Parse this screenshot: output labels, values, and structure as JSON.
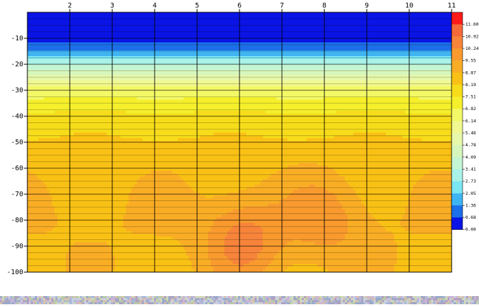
{
  "chart_data": {
    "type": "heatmap",
    "title": "",
    "xlabel": "",
    "ylabel": "",
    "x_ticks": [
      "2",
      "3",
      "4",
      "5",
      "6",
      "7",
      "8",
      "9",
      "10",
      "11"
    ],
    "y_ticks": [
      "-10",
      "-20",
      "-30",
      "-40",
      "-50",
      "-60",
      "-70",
      "-80",
      "-90",
      "-100"
    ],
    "x_range": [
      1,
      11
    ],
    "y_range": [
      0,
      -100
    ],
    "grid": true,
    "legend_position": "right",
    "colorbar": {
      "labels": [
        "11.60",
        "10.92",
        "10.24",
        "9.55",
        "8.87",
        "8.19",
        "7.51",
        "6.82",
        "6.14",
        "5.46",
        "4.78",
        "4.09",
        "3.41",
        "2.73",
        "2.05",
        "1.36",
        "0.68",
        "0.00"
      ],
      "colors": [
        "#ff1a1a",
        "#f66a3a",
        "#f7843a",
        "#f89a2e",
        "#f9ad25",
        "#f9c115",
        "#f6dc1a",
        "#f5ef2c",
        "#f3f866",
        "#f0f890",
        "#e8f8aa",
        "#d6f7bc",
        "#c4f6d3",
        "#a8f2e8",
        "#7ae6f2",
        "#3fb4f2",
        "#1c6fe8",
        "#0a14e6"
      ]
    },
    "depth_profile": [
      {
        "depth": 0,
        "value": 0.3
      },
      {
        "depth": -10,
        "value": 0.4
      },
      {
        "depth": -15,
        "value": 1.4
      },
      {
        "depth": -18,
        "value": 2.6
      },
      {
        "depth": -22,
        "value": 4.1
      },
      {
        "depth": -25,
        "value": 5.2
      },
      {
        "depth": -30,
        "value": 6.4
      },
      {
        "depth": -35,
        "value": 7.1
      },
      {
        "depth": -40,
        "value": 7.7
      },
      {
        "depth": -45,
        "value": 8.0
      },
      {
        "depth": -50,
        "value": 8.3
      },
      {
        "depth": -60,
        "value": 8.6
      },
      {
        "depth": -70,
        "value": 8.8
      },
      {
        "depth": -80,
        "value": 8.9
      },
      {
        "depth": -90,
        "value": 8.8
      },
      {
        "depth": -100,
        "value": 8.7
      }
    ],
    "high_zones": [
      {
        "x": 6.1,
        "depth": -88,
        "value": 10.6
      },
      {
        "x": 8.0,
        "depth": -80,
        "value": 10.0
      }
    ]
  }
}
